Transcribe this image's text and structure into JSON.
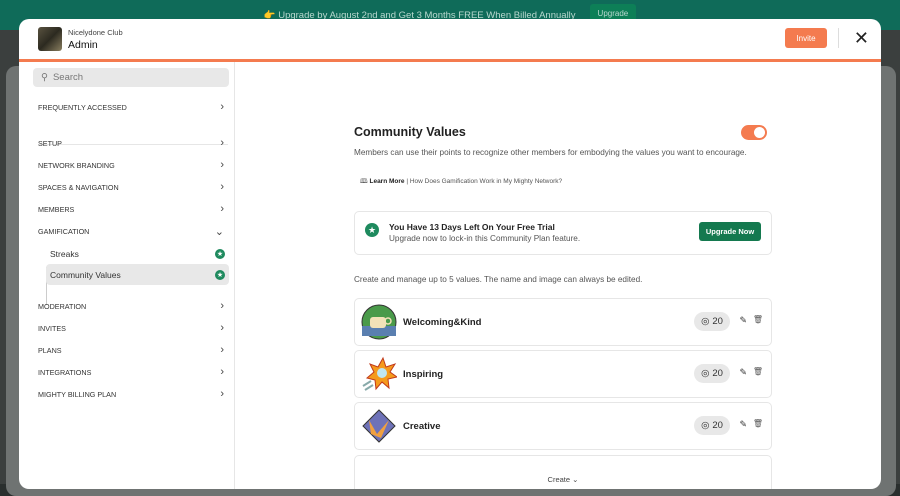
{
  "banner": {
    "text": "👉 Upgrade by August 2nd and Get 3 Months FREE When Billed Annually",
    "button": "Upgrade"
  },
  "header": {
    "club": "Nicelydone Club",
    "title": "Admin",
    "invite": "Invite"
  },
  "sidebar": {
    "search_placeholder": "Search",
    "items": [
      "FREQUENTLY ACCESSED",
      "SETUP",
      "NETWORK BRANDING",
      "SPACES & NAVIGATION",
      "MEMBERS",
      "GAMIFICATION",
      "MODERATION",
      "INVITES",
      "PLANS",
      "INTEGRATIONS",
      "MIGHTY BILLING PLAN"
    ],
    "sub": [
      "Streaks",
      "Community Values"
    ]
  },
  "main": {
    "title": "Community Values",
    "toggle_on": true,
    "description": "Members can use their points to recognize other members for embodying the values you want to encourage.",
    "learn_more": "Learn More",
    "learn_link": "| How Does Gamification Work in My Mighty Network?",
    "trial": {
      "title": "You Have 13 Days Left On Your Free Trial",
      "subtitle": "Upgrade now to lock-in this Community Plan feature.",
      "button": "Upgrade Now"
    },
    "hint": "Create and manage up to 5 values. The name and image can always be edited.",
    "values": [
      {
        "name": "Welcoming&Kind",
        "points": "20"
      },
      {
        "name": "Inspiring",
        "points": "20"
      },
      {
        "name": "Creative",
        "points": "20"
      }
    ],
    "create": "Create"
  }
}
